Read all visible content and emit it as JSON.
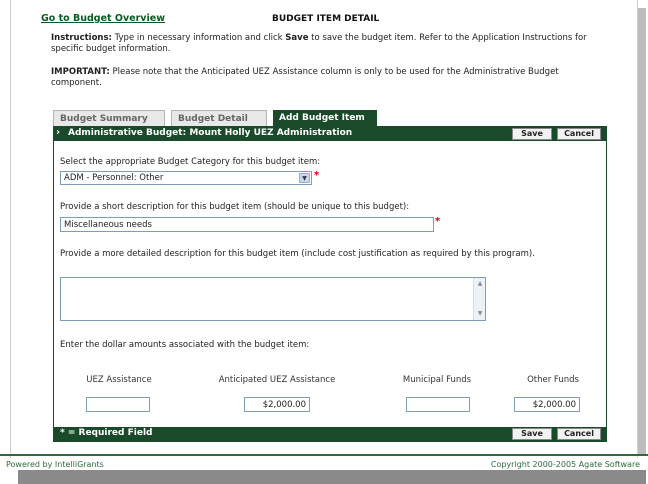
{
  "header": {
    "overview_link": "Go to Budget Overview",
    "title": "BUDGET ITEM DETAIL"
  },
  "instructions": {
    "label": "Instructions:",
    "text_before": " Type in necessary information and click ",
    "save_word": "Save",
    "text_after": " to save the budget item. Refer to the Application Instructions for specific budget information."
  },
  "important": {
    "label": "IMPORTANT:",
    "text": " Please note that the Anticipated UEZ Assistance column is only to be used for the Administrative Budget component."
  },
  "tabs": [
    {
      "label": "Budget Summary",
      "active": false
    },
    {
      "label": "Budget Detail",
      "active": false
    },
    {
      "label": "Add Budget Item",
      "active": true
    }
  ],
  "panel": {
    "title": "Administrative Budget: Mount Holly UEZ Administration",
    "save_label": "Save",
    "cancel_label": "Cancel",
    "footer_note": "* = Required Field",
    "required_marker": "*"
  },
  "form": {
    "category_label": "Select the appropriate Budget Category for this budget item:",
    "category_value": "ADM - Personnel: Other",
    "short_desc_label": "Provide a short description for this budget item (should be unique to this budget):",
    "short_desc_value": "Miscellaneous needs",
    "long_desc_label": "Provide a more detailed description for this budget item (include cost justification as required by this program).",
    "long_desc_value": "",
    "amounts_label": "Enter the dollar amounts associated with the budget item:",
    "columns": [
      {
        "label": "UEZ Assistance",
        "value": ""
      },
      {
        "label": "Anticipated UEZ Assistance",
        "value": "$2,000.00"
      },
      {
        "label": "Municipal Funds",
        "value": ""
      },
      {
        "label": "Other Funds",
        "value": "$2,000.00"
      }
    ]
  },
  "footer": {
    "left": "Powered by IntelliGrants",
    "right": "Copyright 2000-2005 Agate Software"
  },
  "colors": {
    "brand_green": "#1a4a2a",
    "link_green": "#0b5a1f",
    "required_red": "#d00000"
  }
}
